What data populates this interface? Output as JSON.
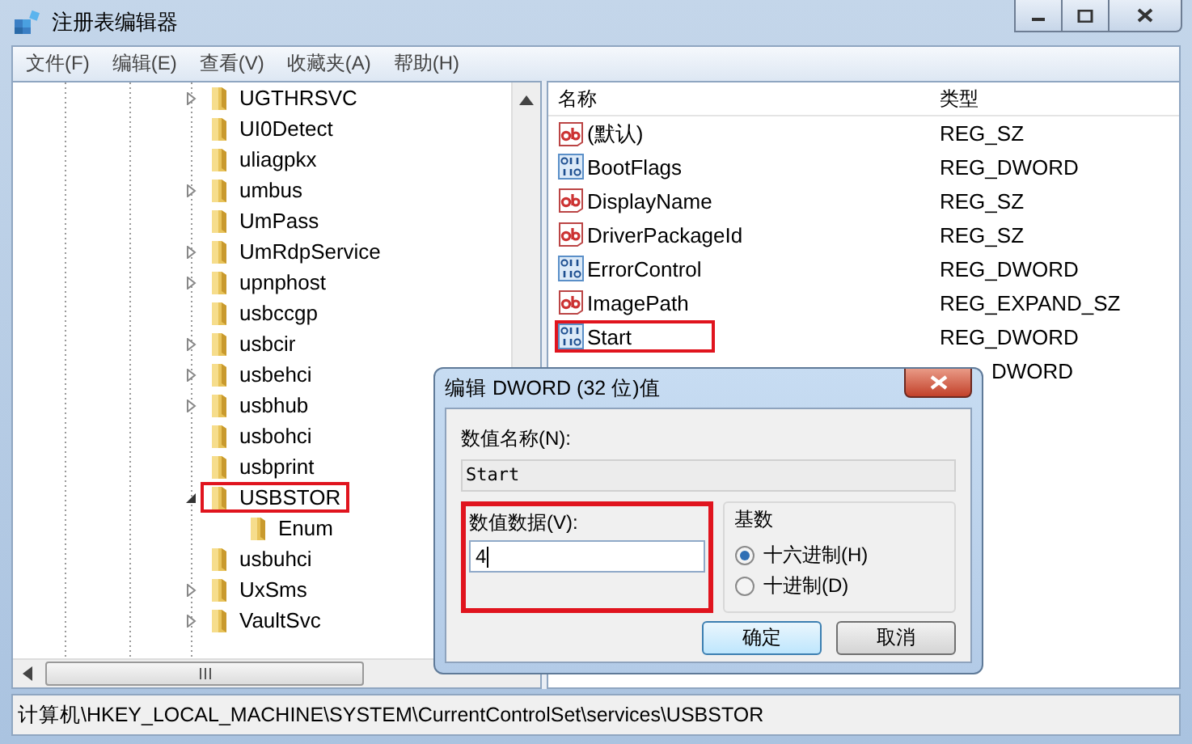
{
  "window": {
    "title": "注册表编辑器"
  },
  "menu": [
    "文件(F)",
    "编辑(E)",
    "查看(V)",
    "收藏夹(A)",
    "帮助(H)"
  ],
  "tree": {
    "items": [
      {
        "label": "UGTHRSVC",
        "expanded": false
      },
      {
        "label": "UI0Detect"
      },
      {
        "label": "uliagpkx"
      },
      {
        "label": "umbus",
        "expanded": false
      },
      {
        "label": "UmPass"
      },
      {
        "label": "UmRdpService",
        "expanded": false
      },
      {
        "label": "upnphost",
        "expanded": false
      },
      {
        "label": "usbccgp"
      },
      {
        "label": "usbcir",
        "expanded": false
      },
      {
        "label": "usbehci",
        "expanded": false
      },
      {
        "label": "usbhub",
        "expanded": false
      },
      {
        "label": "usbohci"
      },
      {
        "label": "usbprint"
      },
      {
        "label": "USBSTOR",
        "expanded": true,
        "highlighted": true,
        "children": [
          {
            "label": "Enum"
          }
        ]
      },
      {
        "label": "usbuhci"
      },
      {
        "label": "UxSms",
        "expanded": false
      },
      {
        "label": "VaultSvc",
        "expanded": false
      }
    ]
  },
  "values": {
    "columns": [
      "名称",
      "类型"
    ],
    "rows": [
      {
        "kind": "string",
        "name": "(默认)",
        "type": "REG_SZ"
      },
      {
        "kind": "binary",
        "name": "BootFlags",
        "type": "REG_DWORD"
      },
      {
        "kind": "string",
        "name": "DisplayName",
        "type": "REG_SZ"
      },
      {
        "kind": "string",
        "name": "DriverPackageId",
        "type": "REG_SZ"
      },
      {
        "kind": "binary",
        "name": "ErrorControl",
        "type": "REG_DWORD"
      },
      {
        "kind": "string",
        "name": "ImagePath",
        "type": "REG_EXPAND_SZ"
      },
      {
        "kind": "binary",
        "name": "Start",
        "type": "REG_DWORD",
        "highlighted": true
      },
      {
        "kind": "partial",
        "type": "DWORD"
      }
    ]
  },
  "dialog": {
    "title": "编辑 DWORD (32 位)值",
    "name_label": "数值名称(N):",
    "name_value": "Start",
    "data_label": "数值数据(V):",
    "data_value": "4",
    "data_highlighted": true,
    "base": {
      "title": "基数",
      "options": [
        {
          "label": "十六进制(H)",
          "selected": true
        },
        {
          "label": "十进制(D)",
          "selected": false
        }
      ]
    },
    "buttons": [
      {
        "label": "确定",
        "default": true
      },
      {
        "label": "取消",
        "default": false
      }
    ]
  },
  "status_bar": "计算机\\HKEY_LOCAL_MACHINE\\SYSTEM\\CurrentControlSet\\services\\USBSTOR"
}
